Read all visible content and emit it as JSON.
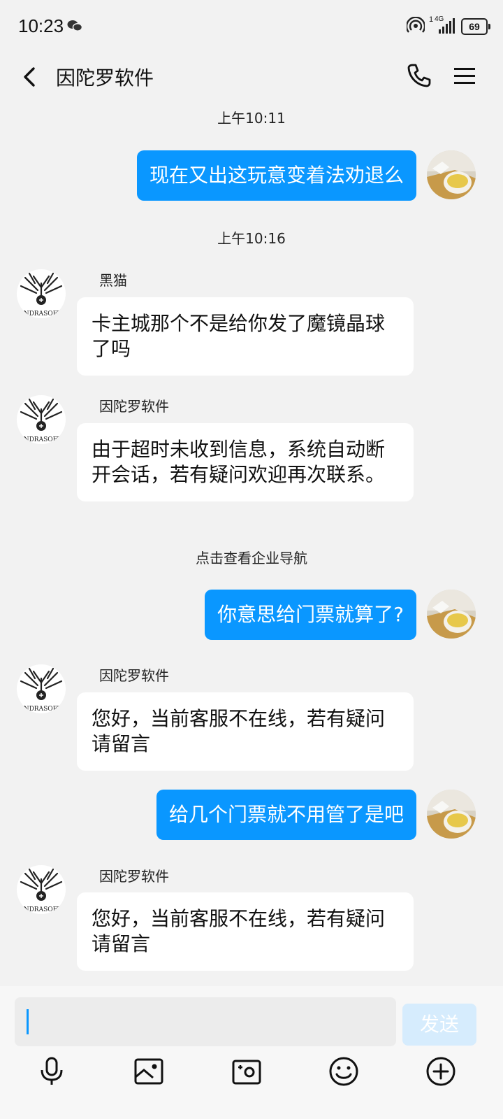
{
  "status_bar": {
    "time": "10:23",
    "signal_small": "1",
    "network": "4G",
    "battery": "69"
  },
  "header": {
    "title": "因陀罗软件",
    "back_icon": "chevron-left-icon",
    "call_icon": "phone-icon",
    "menu_icon": "menu-icon"
  },
  "messages": [
    {
      "type": "timestamp",
      "text": "上午10:11"
    },
    {
      "type": "outgoing",
      "text": "现在又出这玩意变着法劝退么"
    },
    {
      "type": "timestamp",
      "text": "上午10:16"
    },
    {
      "type": "incoming",
      "sender": "黑猫",
      "text": "卡主城那个不是给你发了魔镜晶球了吗"
    },
    {
      "type": "incoming",
      "sender": "因陀罗软件",
      "text": "由于超时未收到信息，系统自动断开会话，若有疑问欢迎再次联系。"
    },
    {
      "type": "notice",
      "text": "点击查看企业导航"
    },
    {
      "type": "outgoing",
      "text": "你意思给门票就算了?"
    },
    {
      "type": "incoming",
      "sender": "因陀罗软件",
      "text": "您好，当前客服不在线，若有疑问请留言"
    },
    {
      "type": "outgoing",
      "text": "给几个门票就不用管了是吧"
    },
    {
      "type": "incoming",
      "sender": "因陀罗软件",
      "text": "您好，当前客服不在线，若有疑问请留言"
    }
  ],
  "avatar_brand_text": "INDRASOFT",
  "input": {
    "value": "",
    "send_label": "发送"
  },
  "toolbar": [
    {
      "icon": "microphone-icon"
    },
    {
      "icon": "image-icon"
    },
    {
      "icon": "camera-icon"
    },
    {
      "icon": "emoji-icon"
    },
    {
      "icon": "plus-icon"
    }
  ],
  "colors": {
    "outgoing_bubble": "#0a97ff",
    "send_button": "#d6ecfd",
    "background": "#f2f2f2"
  }
}
